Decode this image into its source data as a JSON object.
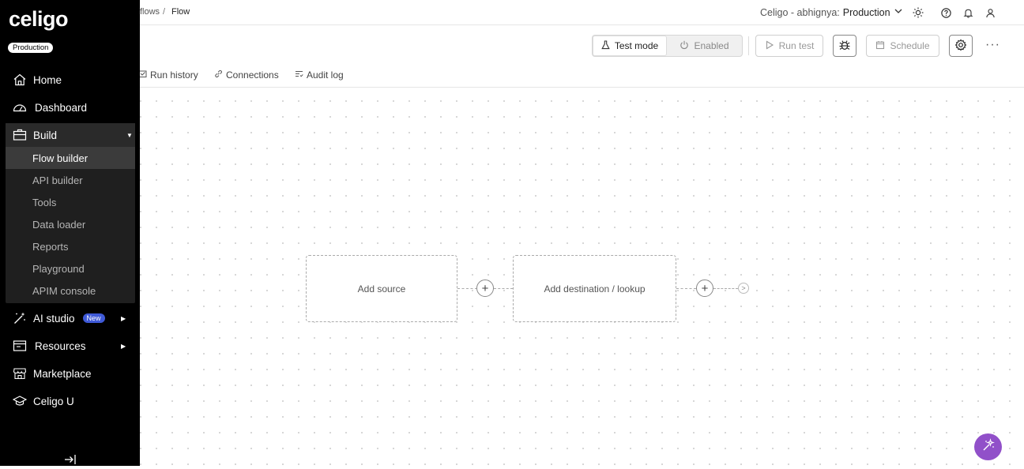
{
  "breadcrumb": {
    "flows": "flows",
    "separator": "/",
    "current": "Flow"
  },
  "account": {
    "prefix": "Celigo - abhignya:",
    "environment": "Production"
  },
  "header": {
    "test_mode": "Test mode",
    "enabled": "Enabled",
    "run_test": "Run test",
    "schedule": "Schedule",
    "more": "···"
  },
  "tabs": [
    {
      "label": "Run history"
    },
    {
      "label": "Connections"
    },
    {
      "label": "Audit log"
    }
  ],
  "canvas": {
    "source": "Add source",
    "destination": "Add destination / lookup",
    "plus": "+",
    "end": ">"
  },
  "sidebar": {
    "logo": "celigo",
    "environment_badge": "Production",
    "items": {
      "home": "Home",
      "dashboard": "Dashboard",
      "build": "Build",
      "ai_studio": "AI studio",
      "ai_badge": "New",
      "resources": "Resources",
      "marketplace": "Marketplace",
      "celigo_u": "Celigo U"
    },
    "build_items": [
      "Flow builder",
      "API builder",
      "Tools",
      "Data loader",
      "Reports",
      "Playground",
      "APIM console"
    ]
  },
  "colors": {
    "sidebar_bg": "#000000",
    "fab": "#9150c9",
    "new_badge": "#3f5ad8"
  }
}
